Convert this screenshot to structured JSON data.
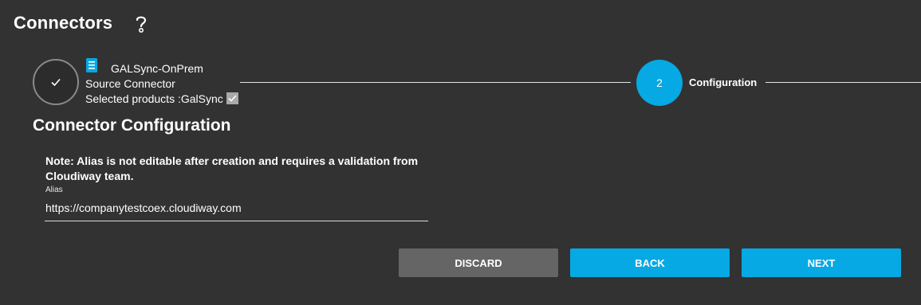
{
  "header": {
    "title": "Connectors",
    "help_icon": "question-mark-icon"
  },
  "stepper": {
    "step1": {
      "status_icon": "checkmark-icon",
      "type_icon": "document-icon",
      "name": "GALSync-OnPrem",
      "type": "Source Connector",
      "products": "Selected products :GalSync"
    },
    "step2": {
      "number": "2",
      "label": "Configuration"
    }
  },
  "section": {
    "title": "Connector Configuration",
    "note": "Note: Alias is not editable after creation and requires a validation from Cloudiway team."
  },
  "alias": {
    "label": "Alias",
    "value": "https://companytestcoex.cloudiway.com"
  },
  "buttons": {
    "discard": "DISCARD",
    "back": "BACK",
    "next": "NEXT"
  },
  "colors": {
    "background": "#323232",
    "accent": "#06a9e3",
    "discard": "#656565"
  }
}
